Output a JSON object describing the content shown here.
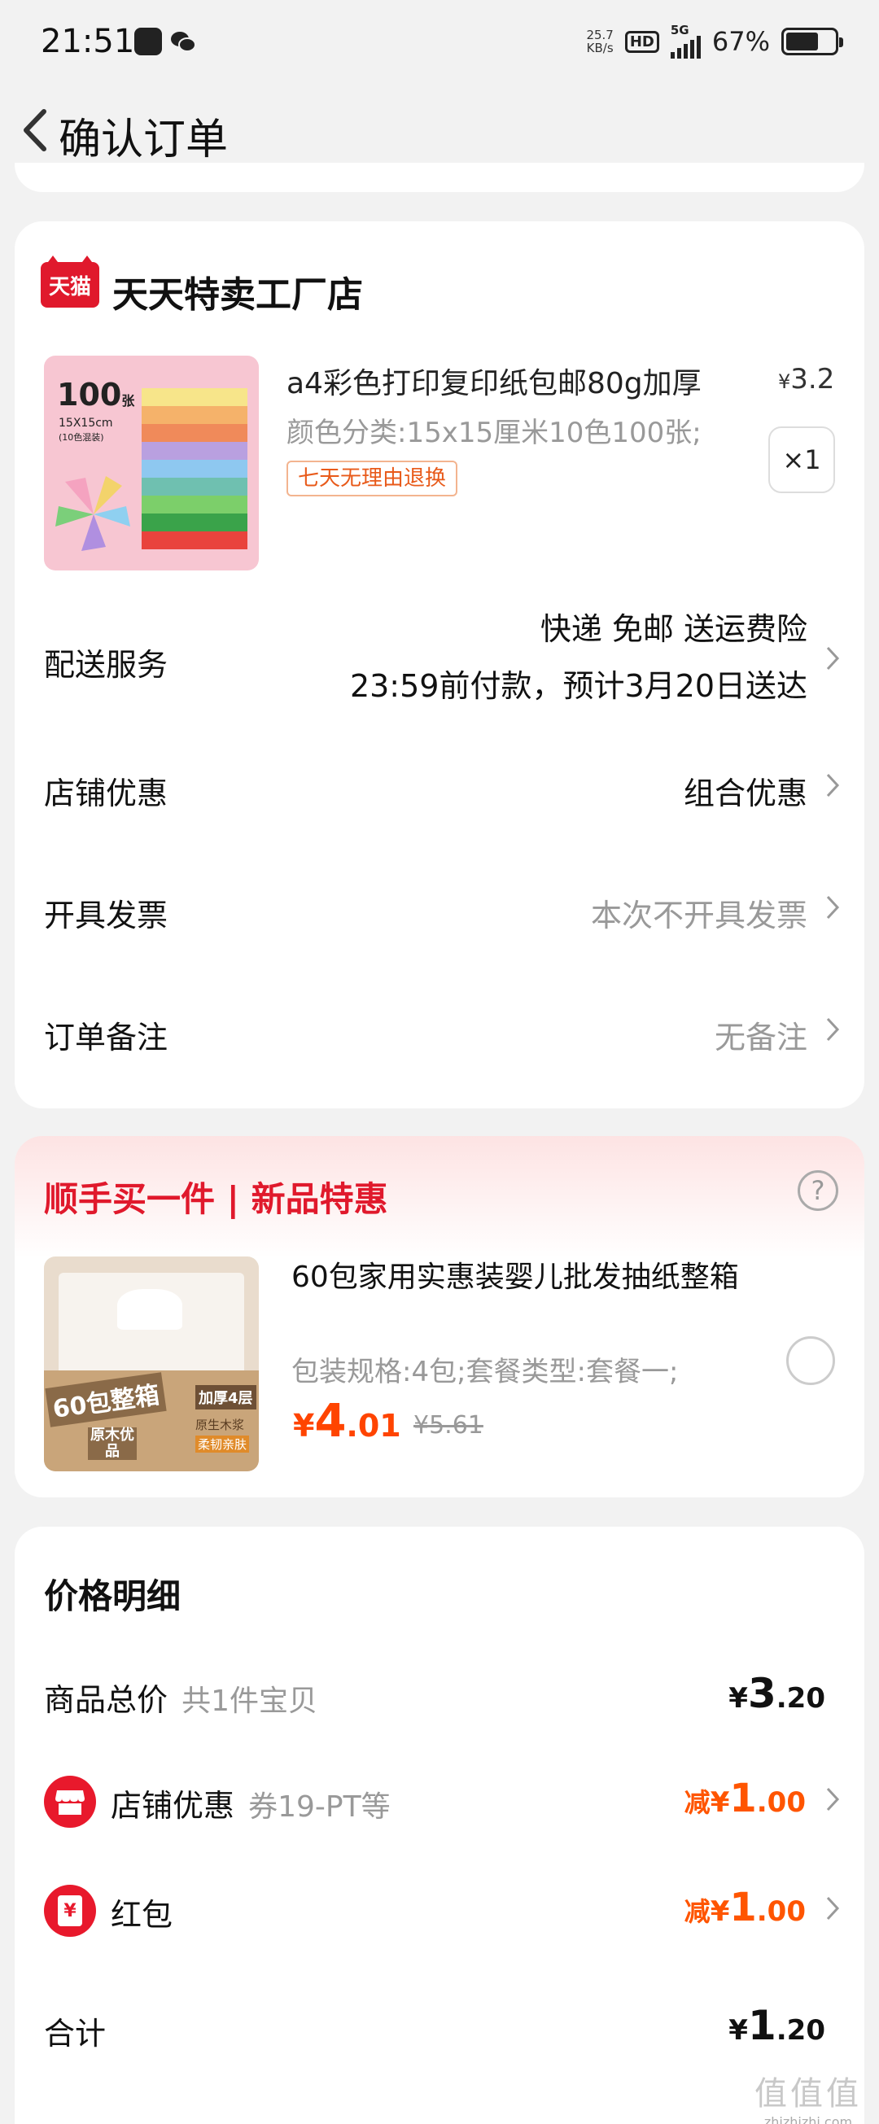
{
  "status_bar": {
    "time": "21:51",
    "net_speed_top": "25.7",
    "net_speed_bottom": "KB/s",
    "hd": "HD",
    "network": "5G",
    "battery": "67%",
    "battery_level": 0.67
  },
  "header": {
    "title": "确认订单",
    "back_icon": "chevron-left-icon"
  },
  "store": {
    "logo_text": "天猫",
    "name": "天天特卖工厂店",
    "product": {
      "image_count": "100",
      "image_count_unit": "张",
      "image_size": "15X15cm",
      "image_note": "(10色混装)",
      "title": "a4彩色打印复印纸包邮80g加厚",
      "price_currency": "¥",
      "price": "3.2",
      "spec": "颜色分类:15x15厘米10色100张;",
      "quantity": "×1",
      "return_tag": "七天无理由退换"
    },
    "delivery": {
      "label": "配送服务",
      "line1": "快递 免邮 送运费险",
      "line2": "23:59前付款，预计3月20日送达"
    },
    "shop_discount": {
      "label": "店铺优惠",
      "value": "组合优惠"
    },
    "invoice": {
      "label": "开具发票",
      "value": "本次不开具发票"
    },
    "remark": {
      "label": "订单备注",
      "value": "无备注"
    }
  },
  "promo": {
    "title": "顺手买一件 | 新品特惠",
    "help_icon": "?",
    "product": {
      "image_badge": "60包整箱",
      "image_tag1": "加厚4层",
      "image_tag2": "原木优品",
      "image_tag3": "原生木浆",
      "image_tag4": "柔韧亲肤",
      "title": "60包家用实惠装婴儿批发抽纸整箱",
      "spec": "包装规格:4包;套餐类型:套餐一;",
      "price_currency": "¥",
      "price_int": "4",
      "price_dec": ".01",
      "original_price": "¥5.61"
    }
  },
  "price_detail": {
    "title": "价格明细",
    "goods_total": {
      "label": "商品总价",
      "sub": "共1件宝贝",
      "currency": "¥",
      "int": "3",
      "dec": ".20"
    },
    "shop_discount": {
      "label": "店铺优惠",
      "sub": "券19-PT等",
      "prefix": "减",
      "currency": "¥",
      "int": "1",
      "dec": ".00"
    },
    "red_packet": {
      "label": "红包",
      "prefix": "减",
      "currency": "¥",
      "int": "1",
      "dec": ".00",
      "icon_glyph": "¥"
    },
    "total": {
      "label": "合计",
      "currency": "¥",
      "int": "1",
      "dec": ".20"
    }
  },
  "watermark": {
    "big": "值值值",
    "small": "zhizhizhi.com"
  },
  "colors": {
    "brand_red": "#e0192c",
    "price_orange": "#ff4400",
    "background": "#f2f2f2"
  }
}
